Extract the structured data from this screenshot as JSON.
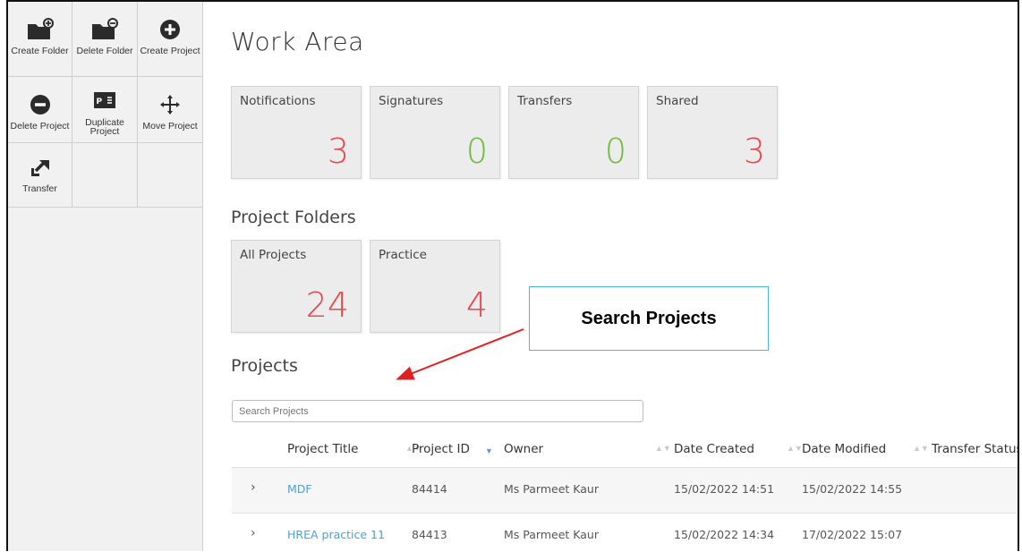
{
  "toolbar": {
    "items": [
      {
        "label": "Create Folder",
        "icon": "folder-add-icon"
      },
      {
        "label": "Delete Folder",
        "icon": "folder-remove-icon"
      },
      {
        "label": "Create Project",
        "icon": "plus-circle-icon"
      },
      {
        "label": "Delete Project",
        "icon": "minus-circle-icon"
      },
      {
        "label": "Duplicate Project",
        "icon": "duplicate-icon"
      },
      {
        "label": "Move Project",
        "icon": "move-icon"
      },
      {
        "label": "Transfer",
        "icon": "transfer-icon"
      }
    ]
  },
  "main": {
    "title": "Work Area",
    "tiles": [
      {
        "label": "Notifications",
        "value": "3",
        "color": "#e8474c"
      },
      {
        "label": "Signatures",
        "value": "0",
        "color": "#6fba3f"
      },
      {
        "label": "Transfers",
        "value": "0",
        "color": "#6fba3f"
      },
      {
        "label": "Shared",
        "value": "3",
        "color": "#e8474c"
      }
    ],
    "folders_title": "Project Folders",
    "folders": [
      {
        "label": "All Projects",
        "value": "24",
        "color": "#e8474c"
      },
      {
        "label": "Practice",
        "value": "4",
        "color": "#e8474c"
      }
    ],
    "projects_title": "Projects",
    "search_placeholder": "Search Projects",
    "columns": [
      "Project Title",
      "Project ID",
      "Owner",
      "Date Created",
      "Date Modified",
      "Transfer Status"
    ],
    "rows": [
      {
        "title": "MDF",
        "id": "84414",
        "owner": "Ms Parmeet Kaur",
        "created": "15/02/2022 14:51",
        "modified": "15/02/2022 14:55"
      },
      {
        "title": "HREA practice 11",
        "id": "84413",
        "owner": "Ms Parmeet Kaur",
        "created": "15/02/2022 14:34",
        "modified": "17/02/2022 15:07"
      }
    ]
  },
  "callout": {
    "text": "Search Projects"
  },
  "colors": {
    "accent_link": "#4ba1d8",
    "count_red": "#e8474c",
    "count_green": "#6fba3f",
    "callout_border": "#4ab7dd",
    "arrow": "#e02020"
  }
}
